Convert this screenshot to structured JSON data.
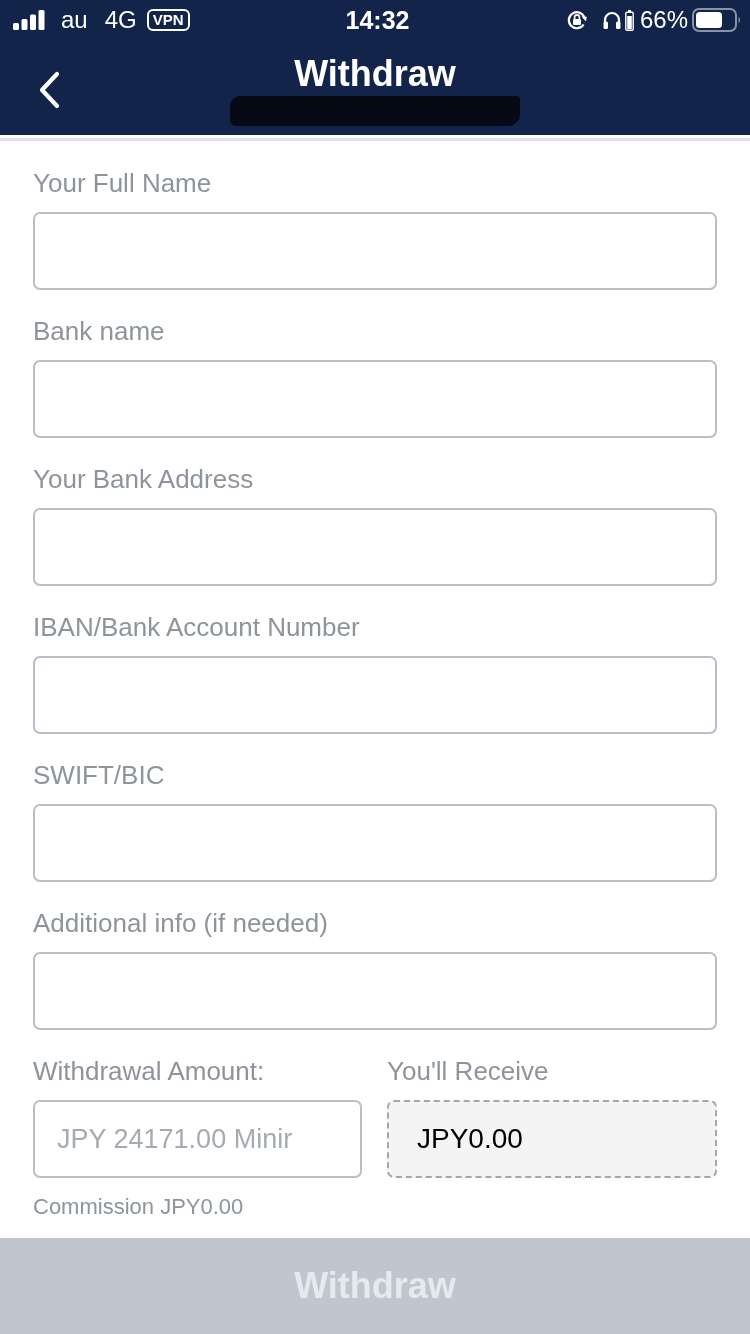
{
  "status_bar": {
    "carrier": "au",
    "network": "4G",
    "vpn": "VPN",
    "time": "14:32",
    "battery": "66%"
  },
  "header": {
    "title": "Withdraw",
    "balance_redacted": true
  },
  "fields": [
    {
      "label": "Your Full Name"
    },
    {
      "label": "Bank name"
    },
    {
      "label": "Your Bank Address"
    },
    {
      "label": "IBAN/Bank Account Number"
    },
    {
      "label": "SWIFT/BIC"
    },
    {
      "label": "Additional info (if needed)"
    }
  ],
  "amount": {
    "label": "Withdrawal Amount:",
    "placeholder": "JPY 24171.00 Minir"
  },
  "receive": {
    "label": "You'll Receive",
    "value": "JPY0.00"
  },
  "commission": "Commission JPY0.00",
  "submit": {
    "label": "Withdraw",
    "disabled": true
  }
}
